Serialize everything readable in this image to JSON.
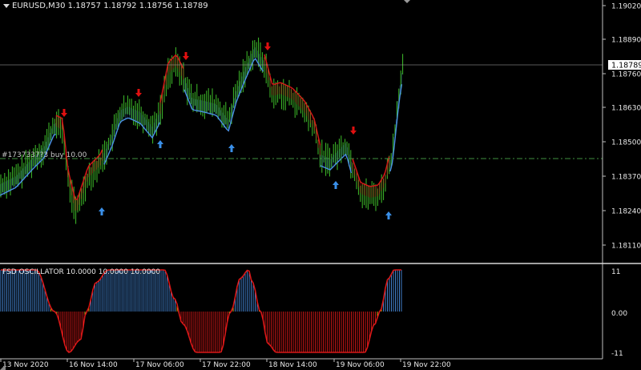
{
  "window": {
    "symbol_info": "EURUSD,M30  1.18757 1.18792 1.18756 1.18789"
  },
  "price_scale": {
    "labels": [
      "1.19020",
      "1.18890",
      "1.18760",
      "1.18630",
      "1.18500",
      "1.18370",
      "1.18240",
      "1.18110"
    ],
    "current_price": "1.18789"
  },
  "order_line": {
    "label": "#1737337?3 buy 10.00"
  },
  "oscillator": {
    "title": "FSD OSCILLATOR 10.0000 10.0000 10.0000",
    "scale_labels": [
      "11",
      "0.00",
      "-11"
    ]
  },
  "time_axis": {
    "labels": [
      "13 Nov 2020",
      "16 Nov 14:00",
      "17 Nov 06:00",
      "17 Nov 22:00",
      "18 Nov 14:00",
      "19 Nov 06:00",
      "19 Nov 22:00"
    ]
  },
  "colors": {
    "background": "#000000",
    "candle_body": "#3fbf2a",
    "band_up": "#4a90e2",
    "band_down": "#d81818",
    "arrow_up": "#3a8fe8",
    "arrow_down": "#e01010",
    "osc_positive": "#4a90e2",
    "osc_negative": "#d81818",
    "osc_transition": "#e8c020",
    "order_line": "#3f8f3f",
    "grid": "#c0c0c0"
  },
  "signals": {
    "up_arrow_icon": "arrow-up-icon",
    "down_arrow_icon": "arrow-down-icon"
  }
}
